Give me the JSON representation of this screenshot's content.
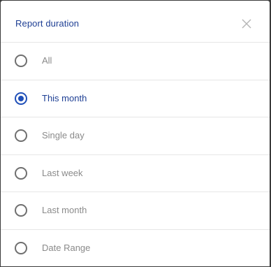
{
  "dialog": {
    "title": "Report duration",
    "close_icon": "close-icon",
    "selected_index": 1,
    "options": [
      {
        "label": "All",
        "checked": false
      },
      {
        "label": "This month",
        "checked": true
      },
      {
        "label": "Single day",
        "checked": false
      },
      {
        "label": "Last week",
        "checked": false
      },
      {
        "label": "Last month",
        "checked": false
      },
      {
        "label": "Date Range",
        "checked": false
      }
    ]
  },
  "colors": {
    "accent": "#1f4fb8",
    "title": "#1e3f94",
    "label": "#8a8a8a",
    "divider": "#e6e6e6"
  }
}
